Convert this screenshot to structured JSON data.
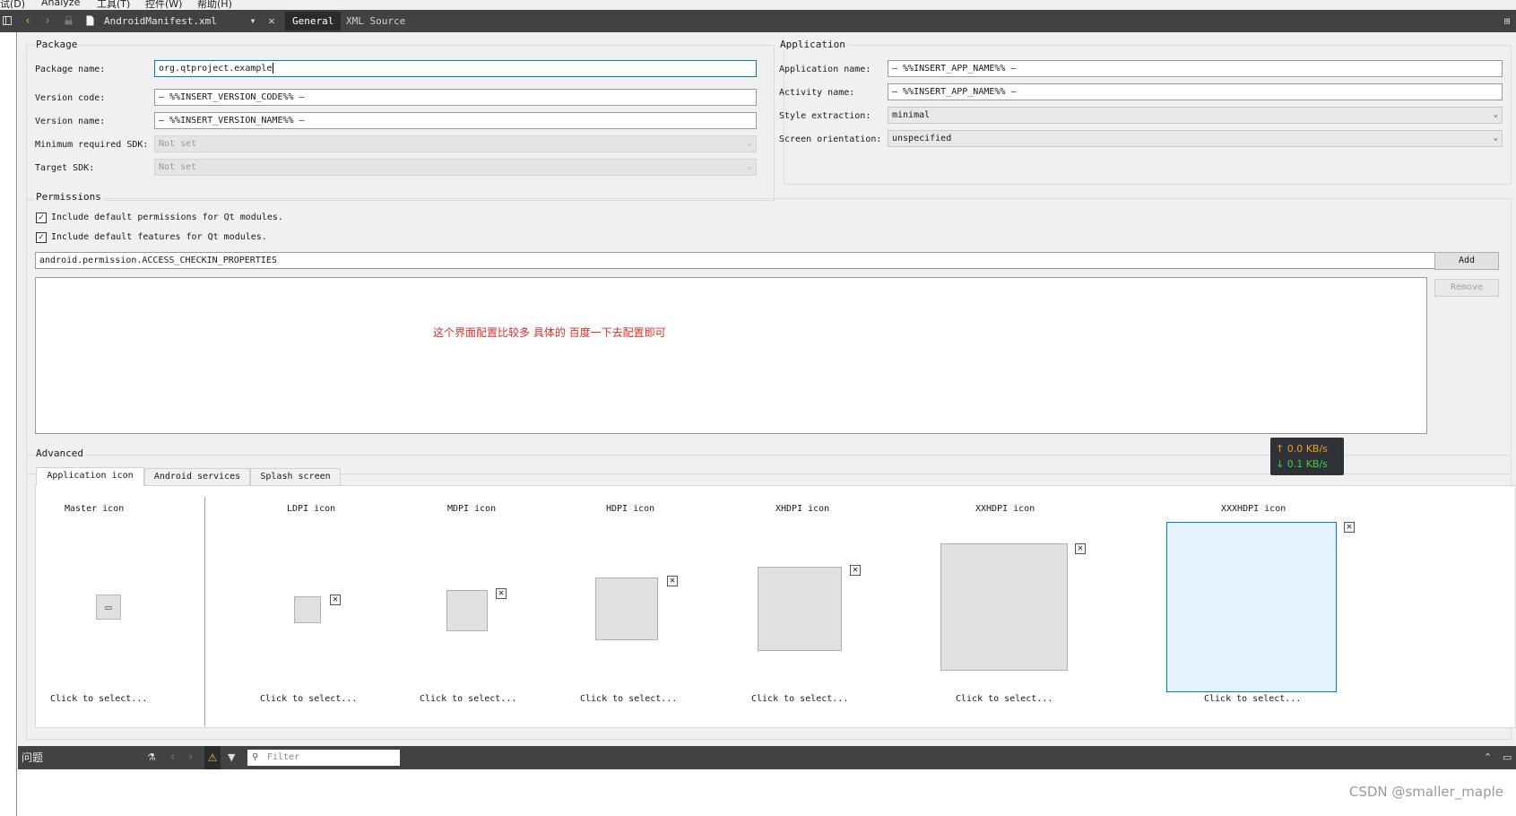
{
  "menu": [
    "试(D)",
    "Analyze",
    "工具(T)",
    "控件(W)",
    "帮助(H)"
  ],
  "toolbar": {
    "file_name": "AndroidManifest.xml",
    "tabs": [
      "General",
      "XML Source"
    ]
  },
  "package": {
    "title": "Package",
    "package_name_label": "Package name:",
    "package_name_value": "org.qtproject.example",
    "version_code_label": "Version code:",
    "version_code_value": "— %%INSERT_VERSION_CODE%% —",
    "version_name_label": "Version name:",
    "version_name_value": "— %%INSERT_VERSION_NAME%% —",
    "min_sdk_label": "Minimum required SDK:",
    "min_sdk_value": "Not set",
    "target_sdk_label": "Target SDK:",
    "target_sdk_value": "Not set"
  },
  "application": {
    "title": "Application",
    "app_name_label": "Application name:",
    "app_name_value": "— %%INSERT_APP_NAME%% —",
    "activity_name_label": "Activity name:",
    "activity_name_value": "— %%INSERT_APP_NAME%% —",
    "style_label": "Style extraction:",
    "style_value": "minimal",
    "orientation_label": "Screen orientation:",
    "orientation_value": "unspecified"
  },
  "permissions": {
    "title": "Permissions",
    "include_permissions": "Include default permissions for Qt modules.",
    "include_features": "Include default features for Qt modules.",
    "selected_permission": "android.permission.ACCESS_CHECKIN_PROPERTIES",
    "add_label": "Add",
    "remove_label": "Remove",
    "note": "这个界面配置比较多 具体的 百度一下去配置即可"
  },
  "network_speed": {
    "up": "↑ 0.0 KB/s",
    "down": "↓ 0.1 KB/s"
  },
  "advanced": {
    "title": "Advanced",
    "tabs": [
      "Application icon",
      "Android services",
      "Splash screen"
    ],
    "icons": [
      "Master icon",
      "LDPI icon",
      "MDPI icon",
      "HDPI icon",
      "XHDPI icon",
      "XXHDPI icon",
      "XXXHDPI icon"
    ],
    "click_to_select": "Click to select..."
  },
  "issues": {
    "title": "问题",
    "filter_placeholder": "Filter"
  },
  "watermark": "CSDN @smaller_maple"
}
